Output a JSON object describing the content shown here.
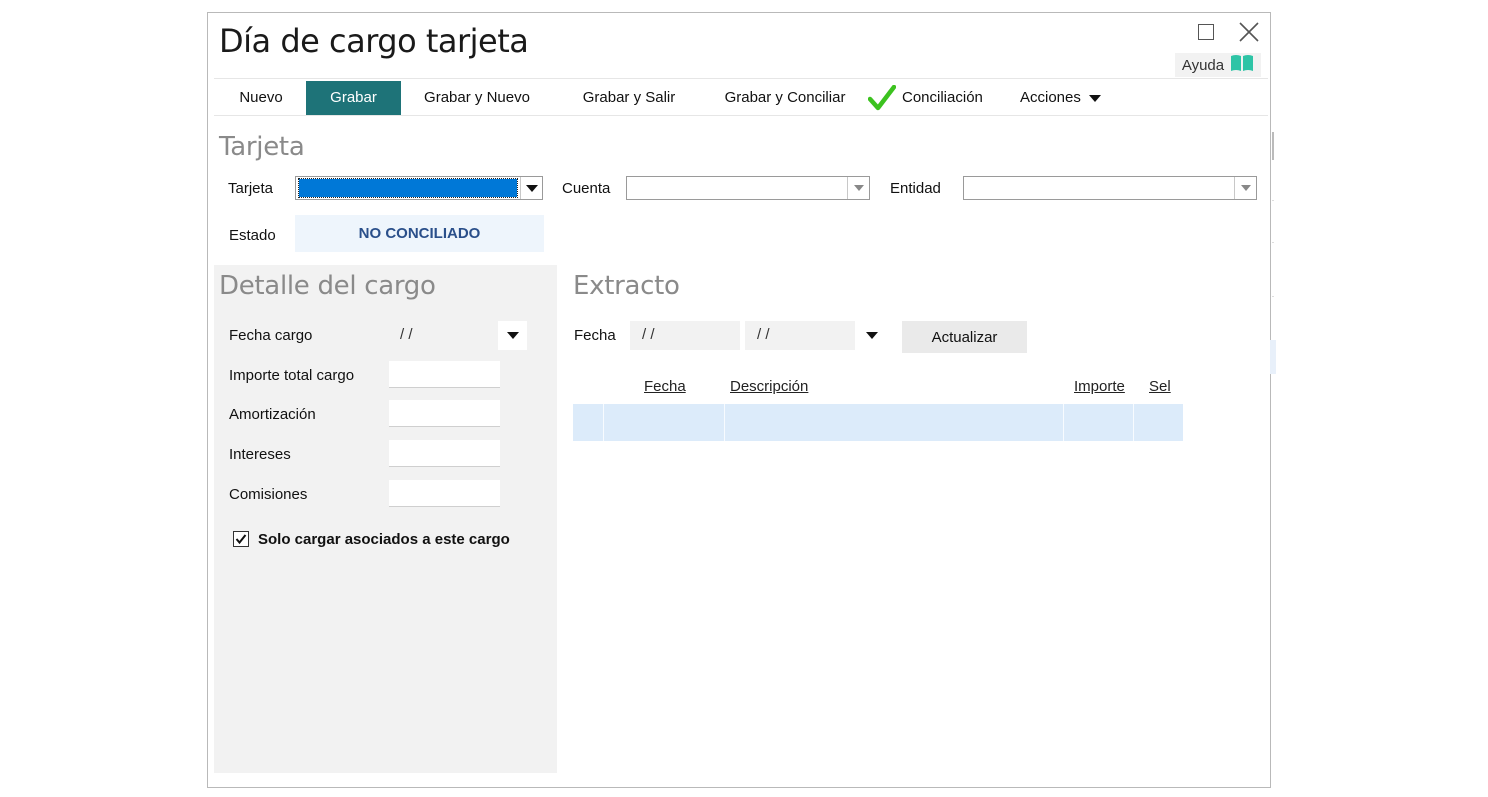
{
  "window": {
    "title": "Día de cargo tarjeta",
    "help_label": "Ayuda",
    "help_icon": "book-icon",
    "maximize_icon": "maximize-icon",
    "close_icon": "close-icon"
  },
  "toolbar": {
    "items": [
      {
        "label": "Nuevo",
        "active": false
      },
      {
        "label": "Grabar",
        "active": true
      },
      {
        "label": "Grabar y Nuevo",
        "active": false
      },
      {
        "label": "Grabar y Salir",
        "active": false
      },
      {
        "label": "Grabar y Conciliar",
        "active": false
      },
      {
        "label": "Conciliación",
        "active": false,
        "icon": "checkmark-icon"
      },
      {
        "label": "Acciones",
        "active": false,
        "icon": "caret-down-icon"
      }
    ]
  },
  "tarjeta_section": {
    "title": "Tarjeta",
    "tarjeta_label": "Tarjeta",
    "tarjeta_value": "",
    "cuenta_label": "Cuenta",
    "cuenta_value": "",
    "entidad_label": "Entidad",
    "entidad_value": "",
    "estado_label": "Estado",
    "estado_value": "NO CONCILIADO"
  },
  "detalle": {
    "title": "Detalle del cargo",
    "fecha_cargo_label": "Fecha cargo",
    "fecha_cargo_value": "/ /",
    "importe_total_label": "Importe total cargo",
    "importe_total_value": "",
    "amortizacion_label": "Amortización",
    "amortizacion_value": "",
    "intereses_label": "Intereses",
    "intereses_value": "",
    "comisiones_label": "Comisiones",
    "comisiones_value": "",
    "solo_cargar_label": "Solo cargar asociados a este cargo",
    "solo_cargar_checked": true
  },
  "extracto": {
    "title": "Extracto",
    "fecha_label": "Fecha",
    "fecha_desde": "/ /",
    "fecha_hasta": "/ /",
    "actualizar_label": "Actualizar",
    "columns": [
      "Fecha",
      "Descripción",
      "Importe",
      "Sel"
    ]
  },
  "colors": {
    "active_button": "#1e7378",
    "selected_combo": "#0078d7",
    "estado_text": "#2a4f8a",
    "estado_bg": "#eef5fc",
    "panel_bg": "#f2f2f2",
    "grid_row": "#dcebfa",
    "check_green": "#3cc21f",
    "help_icon": "#2ec4a6"
  }
}
